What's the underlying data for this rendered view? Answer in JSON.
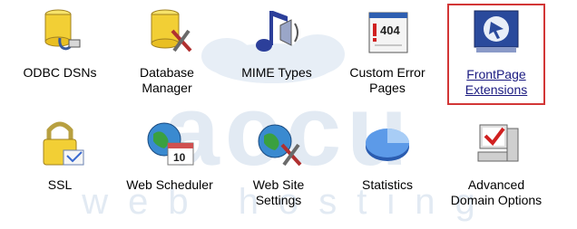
{
  "watermark": {
    "brand": "accu",
    "sub": "web hosting"
  },
  "row1": [
    {
      "label": "ODBC DSNs",
      "icon": "database-plug-icon"
    },
    {
      "label": "Database\nManager",
      "icon": "database-tools-icon"
    },
    {
      "label": "MIME Types",
      "icon": "music-speaker-icon"
    },
    {
      "label": "Custom Error\nPages",
      "icon": "error-404-page-icon"
    },
    {
      "label": "FrontPage\nExtensions",
      "icon": "frontpage-icon",
      "selected": true
    }
  ],
  "row2": [
    {
      "label": "SSL",
      "icon": "padlock-certificate-icon"
    },
    {
      "label": "Web Scheduler",
      "icon": "globe-calendar-icon"
    },
    {
      "label": "Web Site\nSettings",
      "icon": "globe-tools-icon"
    },
    {
      "label": "Statistics",
      "icon": "pie-chart-icon"
    },
    {
      "label": "Advanced\nDomain Options",
      "icon": "computer-checkmark-icon"
    }
  ],
  "colors": {
    "selection": "#d23636",
    "watermark": "#dfe8f2"
  }
}
